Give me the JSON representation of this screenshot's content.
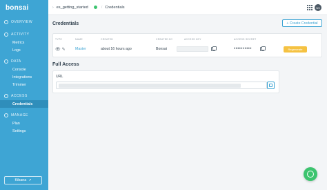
{
  "sidebar": {
    "brand": "bonsai",
    "sections": [
      {
        "label": "OVERVIEW"
      },
      {
        "label": "ACTIVITY",
        "items": [
          "Metrics",
          "Logs"
        ]
      },
      {
        "label": "DATA",
        "items": [
          "Console",
          "Integrations",
          "Trimmer"
        ]
      },
      {
        "label": "ACCESS",
        "items": [
          "Credentials"
        ]
      },
      {
        "label": "MANAGE",
        "items": [
          "Plan",
          "Settings"
        ]
      }
    ],
    "kibana_label": "Kibana"
  },
  "topbar": {
    "cluster": "es_getting_started",
    "page": "Credentials",
    "avatar_initials": "NS"
  },
  "credentials": {
    "title": "Credentials",
    "create_label": "+ Create Credential",
    "columns": [
      "TYPE",
      "NAME",
      "CREATED",
      "CREATED BY",
      "ACCESS KEY",
      "ACCESS SECRET"
    ],
    "row": {
      "name": "Master",
      "created": "about 16 hours ago",
      "created_by": "Bonsai",
      "secret": "••••••••••",
      "regenerate_label": "Regenerate"
    }
  },
  "full_access": {
    "title": "Full Access",
    "url_label": "URL"
  },
  "colors": {
    "sidebar": "#3ea5d4",
    "accent": "#3ea5d4",
    "status": "#3cc46f",
    "warning": "#f5c242"
  }
}
